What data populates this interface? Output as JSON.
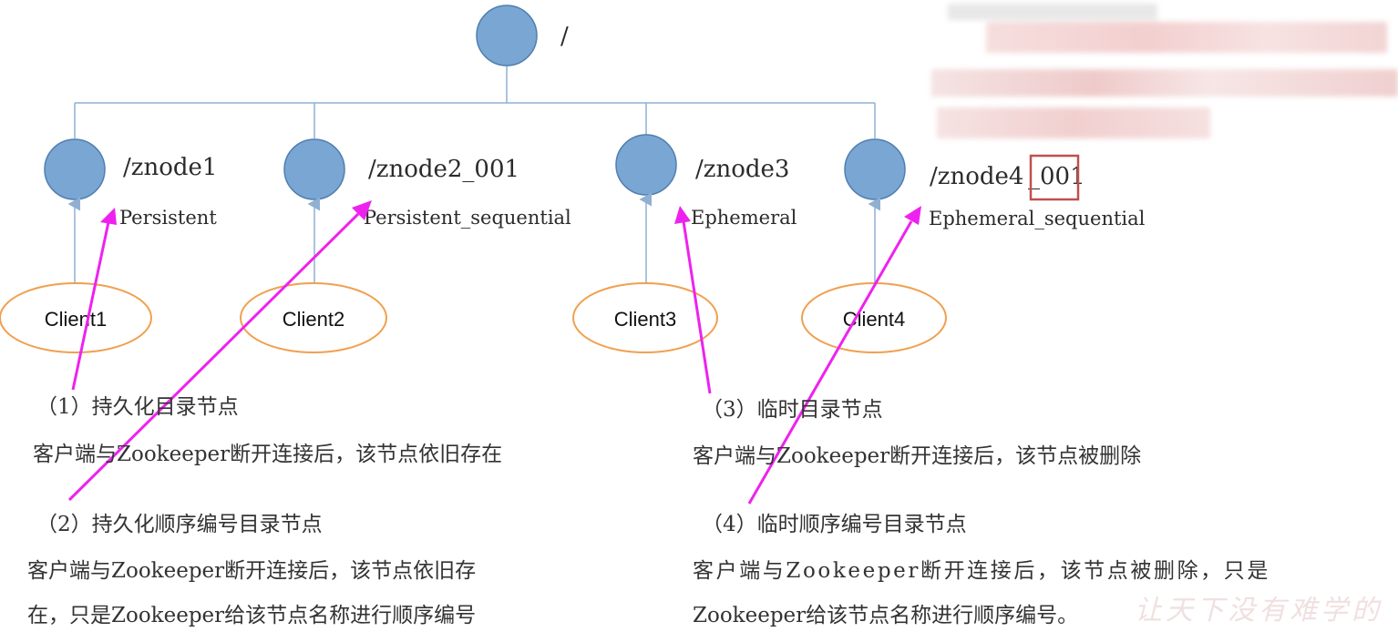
{
  "root": {
    "label": "/"
  },
  "nodes": [
    {
      "name": "/znode1",
      "type": "Persistent",
      "client": "Client1"
    },
    {
      "name": "/znode2_001",
      "type": "Persistent_sequential",
      "client": "Client2"
    },
    {
      "name": "/znode3",
      "type": "Ephemeral",
      "client": "Client3"
    },
    {
      "name": "/znode4",
      "suffix": "_001",
      "type": "Ephemeral_sequential",
      "client": "Client4"
    }
  ],
  "descriptions": [
    {
      "heading": "（1）持久化目录节点",
      "body": "客户端与Zookeeper断开连接后，该节点依旧存在"
    },
    {
      "heading": "（2）持久化顺序编号目录节点",
      "body_line1": "客户端与Zookeeper断开连接后，该节点依旧存",
      "body_line2": "在，只是Zookeeper给该节点名称进行顺序编号"
    },
    {
      "heading": "（3）临时目录节点",
      "body": "客户端与Zookeeper断开连接后，该节点被删除"
    },
    {
      "heading": "（4）临时顺序编号目录节点",
      "body_line1": "客户端与Zookeeper断开连接后，该节点被删除，只是",
      "body_line2": "Zookeeper给该节点名称进行顺序编号。"
    }
  ],
  "watermark": "让天下没有难学的",
  "colors": {
    "node_fill": "#7aa6d4",
    "node_stroke": "#4f7fb0",
    "tree_line": "#8fb0d2",
    "client_stroke": "#f0a050",
    "arrow": "#ee22ee",
    "highlight_box": "#c0504d"
  }
}
